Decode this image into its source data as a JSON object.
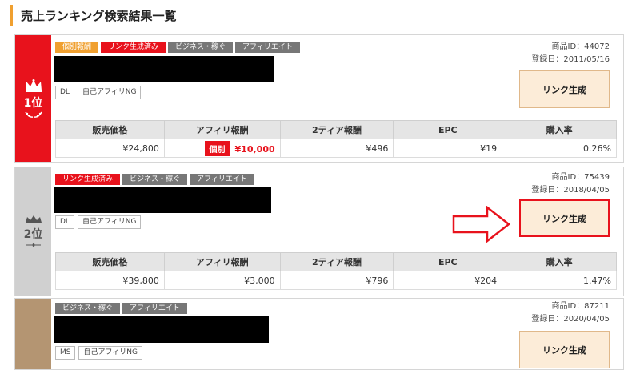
{
  "page_title": "売上ランキング検索結果一覧",
  "columns": [
    "販売価格",
    "アフィリ報酬",
    "2ティア報酬",
    "EPC",
    "購入率"
  ],
  "link_button_label": "リンク生成",
  "kobetsu_label": "個別",
  "products": [
    {
      "rank": "1位",
      "tags": [
        "個別報酬",
        "リンク生成済み",
        "ビジネス・稼ぐ",
        "アフィリエイト"
      ],
      "badges": [
        "DL",
        "自己アフィリNG"
      ],
      "product_id": "商品ID：44072",
      "registered": "登録日：2011/05/16",
      "price": "¥24,800",
      "affiliate_reward": "¥10,000",
      "tier2_reward": "¥496",
      "epc": "¥19",
      "purchase_rate": "0.26%"
    },
    {
      "rank": "2位",
      "tags": [
        "リンク生成済み",
        "ビジネス・稼ぐ",
        "アフィリエイト"
      ],
      "badges": [
        "DL",
        "自己アフィリNG"
      ],
      "product_id": "商品ID：75439",
      "registered": "登録日：2018/04/05",
      "price": "¥39,800",
      "affiliate_reward": "¥3,000",
      "tier2_reward": "¥796",
      "epc": "¥204",
      "purchase_rate": "1.47%"
    },
    {
      "rank": "",
      "tags": [
        "ビジネス・稼ぐ",
        "アフィリエイト"
      ],
      "badges": [
        "MS",
        "自己アフィリNG"
      ],
      "product_id": "商品ID：87211",
      "registered": "登録日：2020/04/05"
    }
  ],
  "colors": {
    "red": "#e8121c",
    "orange": "#f0a030",
    "silver": "#d0d0d0",
    "bronze": "#b49572",
    "button_bg": "#fcecd8"
  },
  "icons": [
    "crown-icon",
    "laurel-icon",
    "right-arrow-icon"
  ]
}
